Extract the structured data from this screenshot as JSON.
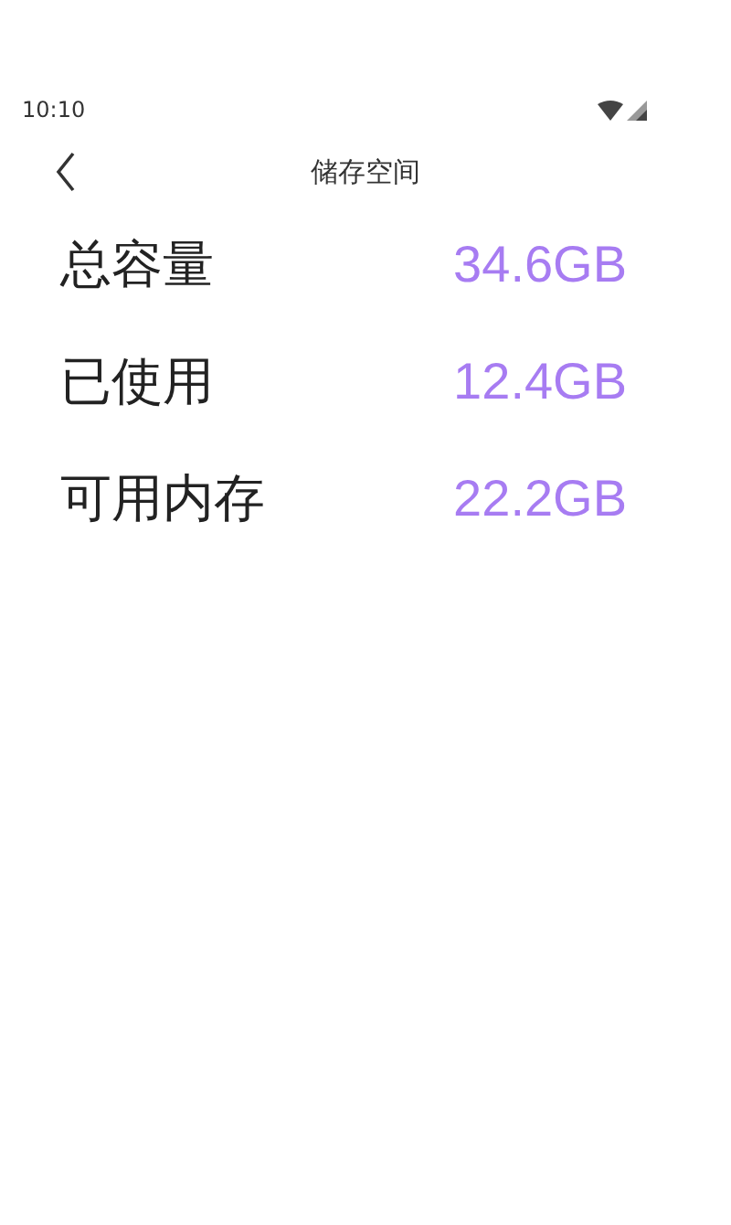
{
  "status_bar": {
    "time": "10:10"
  },
  "header": {
    "title": "储存空间"
  },
  "rows": [
    {
      "label": "总容量",
      "value": "34.6GB"
    },
    {
      "label": "已使用",
      "value": "12.4GB"
    },
    {
      "label": "可用内存",
      "value": "22.2GB"
    }
  ]
}
